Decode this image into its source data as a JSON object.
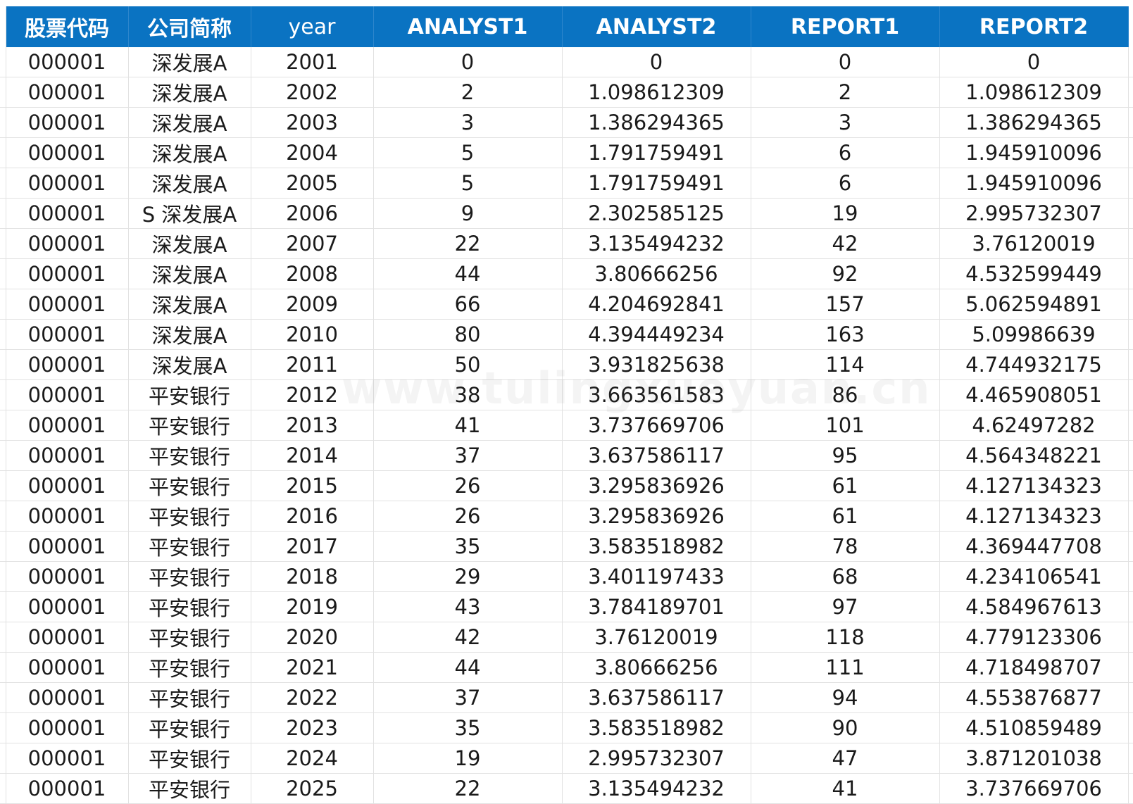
{
  "header": {
    "columns": [
      "股票代码",
      "公司简称",
      "year",
      "ANALYST1",
      "ANALYST2",
      "REPORT1",
      "REPORT2"
    ]
  },
  "rows": [
    [
      "000001",
      "深发展A",
      "2001",
      "0",
      "0",
      "0",
      "0"
    ],
    [
      "000001",
      "深发展A",
      "2002",
      "2",
      "1.098612309",
      "2",
      "1.098612309"
    ],
    [
      "000001",
      "深发展A",
      "2003",
      "3",
      "1.386294365",
      "3",
      "1.386294365"
    ],
    [
      "000001",
      "深发展A",
      "2004",
      "5",
      "1.791759491",
      "6",
      "1.945910096"
    ],
    [
      "000001",
      "深发展A",
      "2005",
      "5",
      "1.791759491",
      "6",
      "1.945910096"
    ],
    [
      "000001",
      "S 深发展A",
      "2006",
      "9",
      "2.302585125",
      "19",
      "2.995732307"
    ],
    [
      "000001",
      "深发展A",
      "2007",
      "22",
      "3.135494232",
      "42",
      "3.76120019"
    ],
    [
      "000001",
      "深发展A",
      "2008",
      "44",
      "3.80666256",
      "92",
      "4.532599449"
    ],
    [
      "000001",
      "深发展A",
      "2009",
      "66",
      "4.204692841",
      "157",
      "5.062594891"
    ],
    [
      "000001",
      "深发展A",
      "2010",
      "80",
      "4.394449234",
      "163",
      "5.09986639"
    ],
    [
      "000001",
      "深发展A",
      "2011",
      "50",
      "3.931825638",
      "114",
      "4.744932175"
    ],
    [
      "000001",
      "平安银行",
      "2012",
      "38",
      "3.663561583",
      "86",
      "4.465908051"
    ],
    [
      "000001",
      "平安银行",
      "2013",
      "41",
      "3.737669706",
      "101",
      "4.62497282"
    ],
    [
      "000001",
      "平安银行",
      "2014",
      "37",
      "3.637586117",
      "95",
      "4.564348221"
    ],
    [
      "000001",
      "平安银行",
      "2015",
      "26",
      "3.295836926",
      "61",
      "4.127134323"
    ],
    [
      "000001",
      "平安银行",
      "2016",
      "26",
      "3.295836926",
      "61",
      "4.127134323"
    ],
    [
      "000001",
      "平安银行",
      "2017",
      "35",
      "3.583518982",
      "78",
      "4.369447708"
    ],
    [
      "000001",
      "平安银行",
      "2018",
      "29",
      "3.401197433",
      "68",
      "4.234106541"
    ],
    [
      "000001",
      "平安银行",
      "2019",
      "43",
      "3.784189701",
      "97",
      "4.584967613"
    ],
    [
      "000001",
      "平安银行",
      "2020",
      "42",
      "3.76120019",
      "118",
      "4.779123306"
    ],
    [
      "000001",
      "平安银行",
      "2021",
      "44",
      "3.80666256",
      "111",
      "4.718498707"
    ],
    [
      "000001",
      "平安银行",
      "2022",
      "37",
      "3.637586117",
      "94",
      "4.553876877"
    ],
    [
      "000001",
      "平安银行",
      "2023",
      "35",
      "3.583518982",
      "90",
      "4.510859489"
    ],
    [
      "000001",
      "平安银行",
      "2024",
      "19",
      "2.995732307",
      "47",
      "3.871201038"
    ],
    [
      "000001",
      "平安银行",
      "2025",
      "22",
      "3.135494232",
      "41",
      "3.737669706"
    ]
  ],
  "watermark": "www.tulingxueyuan.cn",
  "colors": {
    "header_bg": "#0a73c2",
    "header_text": "#ffffff",
    "grid_line": "#e2e2e2",
    "cell_text": "#1a1a1a"
  }
}
